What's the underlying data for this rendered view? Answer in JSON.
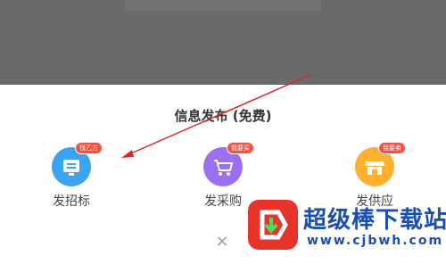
{
  "sheet": {
    "title": "信息发布 (免费)",
    "items": [
      {
        "label": "发招标",
        "badge": "找乙方",
        "color": "#3aa4f0"
      },
      {
        "label": "发采购",
        "badge": "我要买",
        "color": "#9b6ef2"
      },
      {
        "label": "发供应",
        "badge": "我要卖",
        "color": "#ffb02e"
      }
    ],
    "close_glyph": "×"
  },
  "watermark": {
    "text": "超级棒下载站",
    "url": "www.cjbwh.com"
  },
  "colors": {
    "overlay": "#6a6a6a",
    "badge": "#ff4d3c",
    "arrow": "#e0282a"
  }
}
